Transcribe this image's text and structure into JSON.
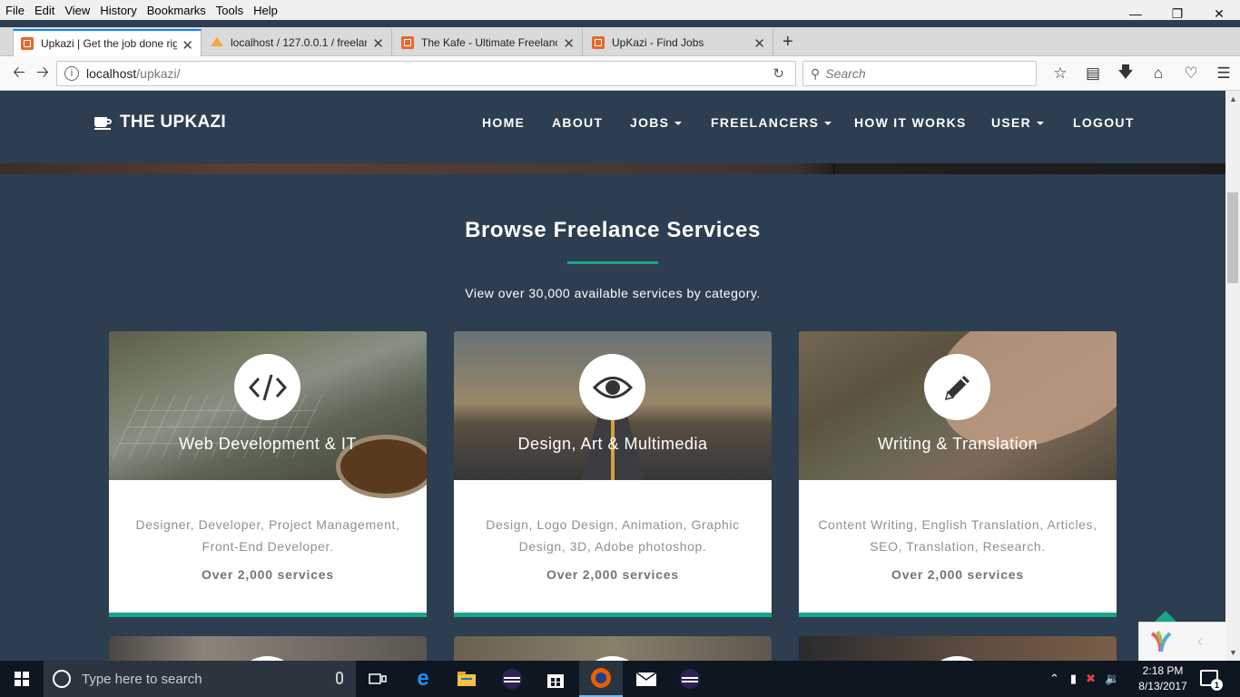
{
  "menubar": {
    "items": [
      "File",
      "Edit",
      "View",
      "History",
      "Bookmarks",
      "Tools",
      "Help"
    ]
  },
  "tabs": [
    {
      "title": "Upkazi | Get the job done rig"
    },
    {
      "title": "localhost / 127.0.0.1 / freelan"
    },
    {
      "title": "The Kafe - Ultimate Freelanc"
    },
    {
      "title": "UpKazi - Find Jobs"
    }
  ],
  "navbar": {
    "url_host": "localhost",
    "url_path": "/upkazi/",
    "search_placeholder": "Search"
  },
  "site": {
    "brand": "THE UPKAZI",
    "nav": [
      "HOME",
      "ABOUT",
      "JOBS",
      "FREELANCERS",
      "HOW IT WORKS",
      "USER",
      "LOGOUT"
    ]
  },
  "section": {
    "title": "Browse Freelance Services",
    "subtitle": "View over 30,000 available services by category."
  },
  "cards": [
    {
      "icon": "code-icon",
      "category": "Web Development & IT",
      "description": "Designer, Developer, Project Management, Front-End Developer.",
      "count": "Over 2,000 services"
    },
    {
      "icon": "eye-icon",
      "category": "Design, Art & Multimedia",
      "description": "Design, Logo Design, Animation, Graphic Design, 3D, Adobe photoshop.",
      "count": "Over 2,000 services"
    },
    {
      "icon": "pencil-icon",
      "category": "Writing & Translation",
      "description": "Content Writing, English Translation, Articles, SEO, Translation, Research.",
      "count": "Over 2,000 services"
    }
  ],
  "taskbar": {
    "search_placeholder": "Type here to search",
    "time": "2:18 PM",
    "date": "8/13/2017",
    "notification_count": "1"
  },
  "colors": {
    "page_bg": "#2c3e50",
    "accent": "#18a689"
  }
}
